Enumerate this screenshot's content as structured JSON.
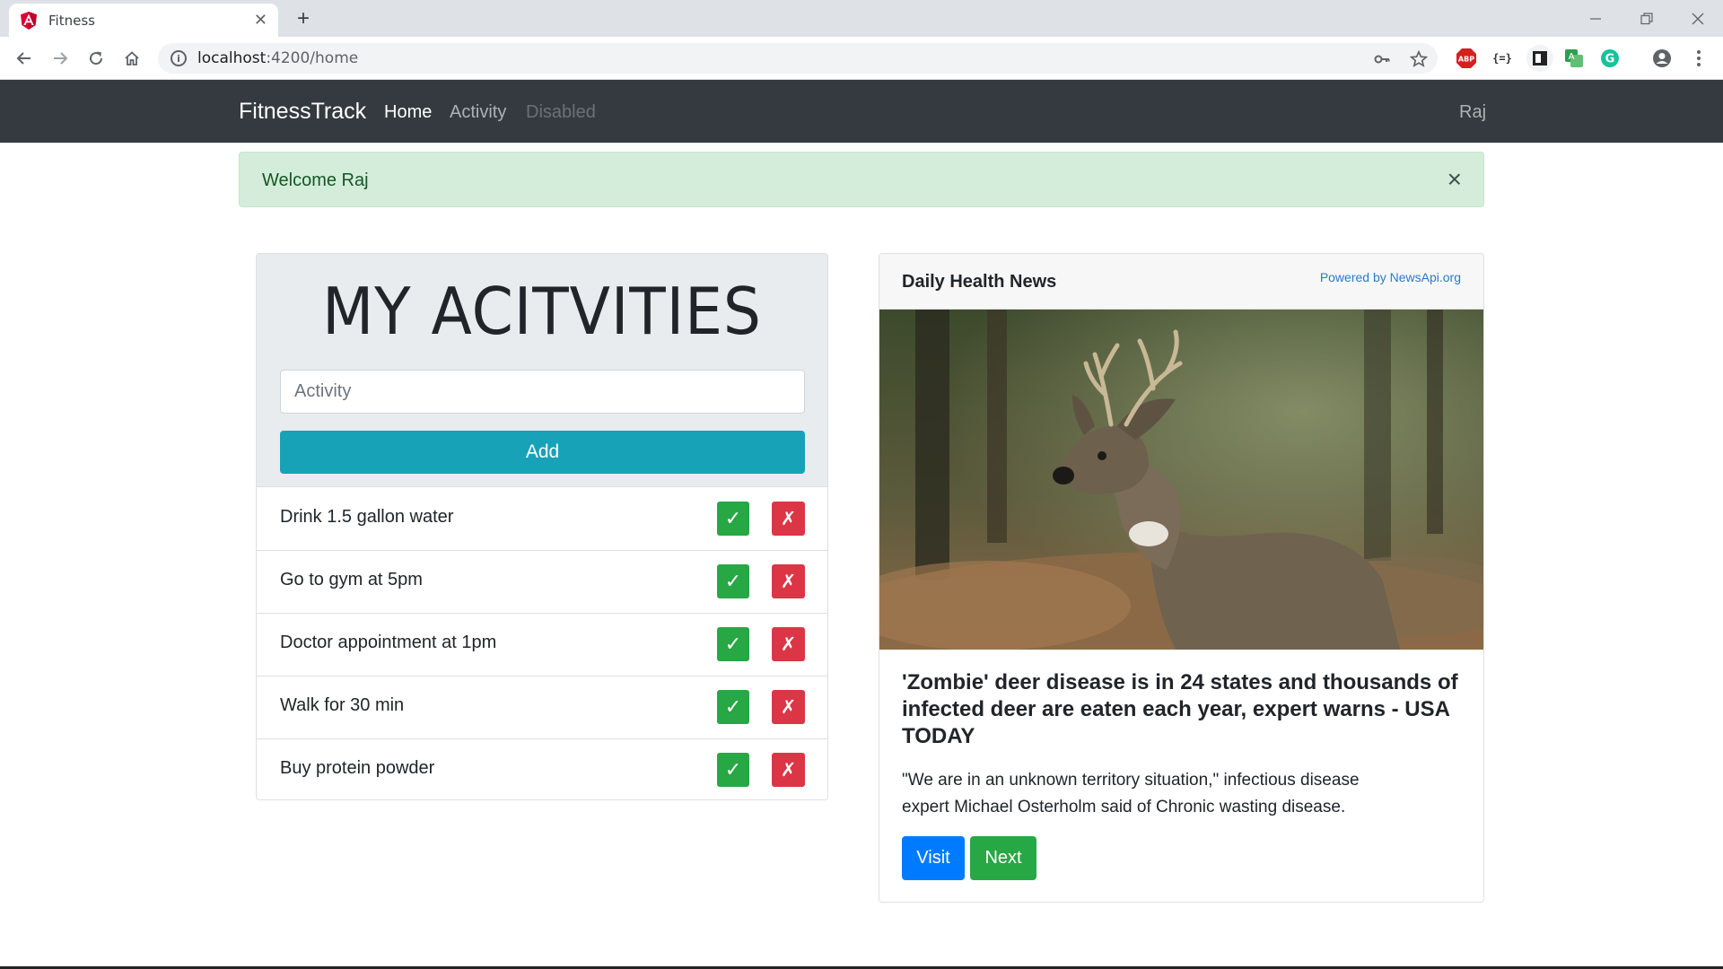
{
  "browser": {
    "tab_title": "Fitness",
    "url_host": "localhost",
    "url_path": ":4200/home"
  },
  "nav": {
    "brand": "FitnessTrack",
    "links": [
      {
        "label": "Home",
        "state": "active"
      },
      {
        "label": "Activity",
        "state": "normal"
      },
      {
        "label": "Disabled",
        "state": "disabled"
      }
    ],
    "user": "Raj"
  },
  "alert": {
    "message": "Welcome Raj",
    "close_symbol": "×"
  },
  "activities": {
    "heading": "MY ACITVITIES",
    "input_placeholder": "Activity",
    "add_label": "Add",
    "complete_symbol": "✓",
    "remove_symbol": "✗",
    "items": [
      {
        "label": "Drink 1.5 gallon water"
      },
      {
        "label": "Go to gym at 5pm"
      },
      {
        "label": "Doctor appointment at 1pm"
      },
      {
        "label": "Walk for 30 min"
      },
      {
        "label": "Buy protein powder"
      }
    ]
  },
  "news": {
    "header": "Daily Health News",
    "powered_by": "Powered by NewsApi.org",
    "title": "'Zombie' deer disease is in 24 states and thousands of infected deer are eaten each year, expert warns - USA TODAY",
    "description": "\"We are in an unknown territory situation,\" infectious disease expert Michael Osterholm said of Chronic wasting disease.",
    "visit_label": "Visit",
    "next_label": "Next"
  },
  "colors": {
    "navbar_bg": "#343a40",
    "alert_bg": "#d4edda",
    "add_button": "#17a2b8",
    "success": "#28a745",
    "danger": "#dc3545",
    "primary": "#007bff"
  },
  "icons": {
    "tab_favicon": "angular-icon",
    "back": "back-arrow-icon",
    "forward": "forward-arrow-icon",
    "reload": "reload-icon",
    "home": "home-icon",
    "site_info": "info-icon",
    "key": "key-icon",
    "bookmark": "star-icon",
    "extensions": [
      "adblock-icon",
      "json-formatter-icon",
      "reader-icon",
      "translate-icon",
      "grammarly-icon"
    ],
    "profile": "profile-icon",
    "menu": "kebab-menu-icon"
  }
}
